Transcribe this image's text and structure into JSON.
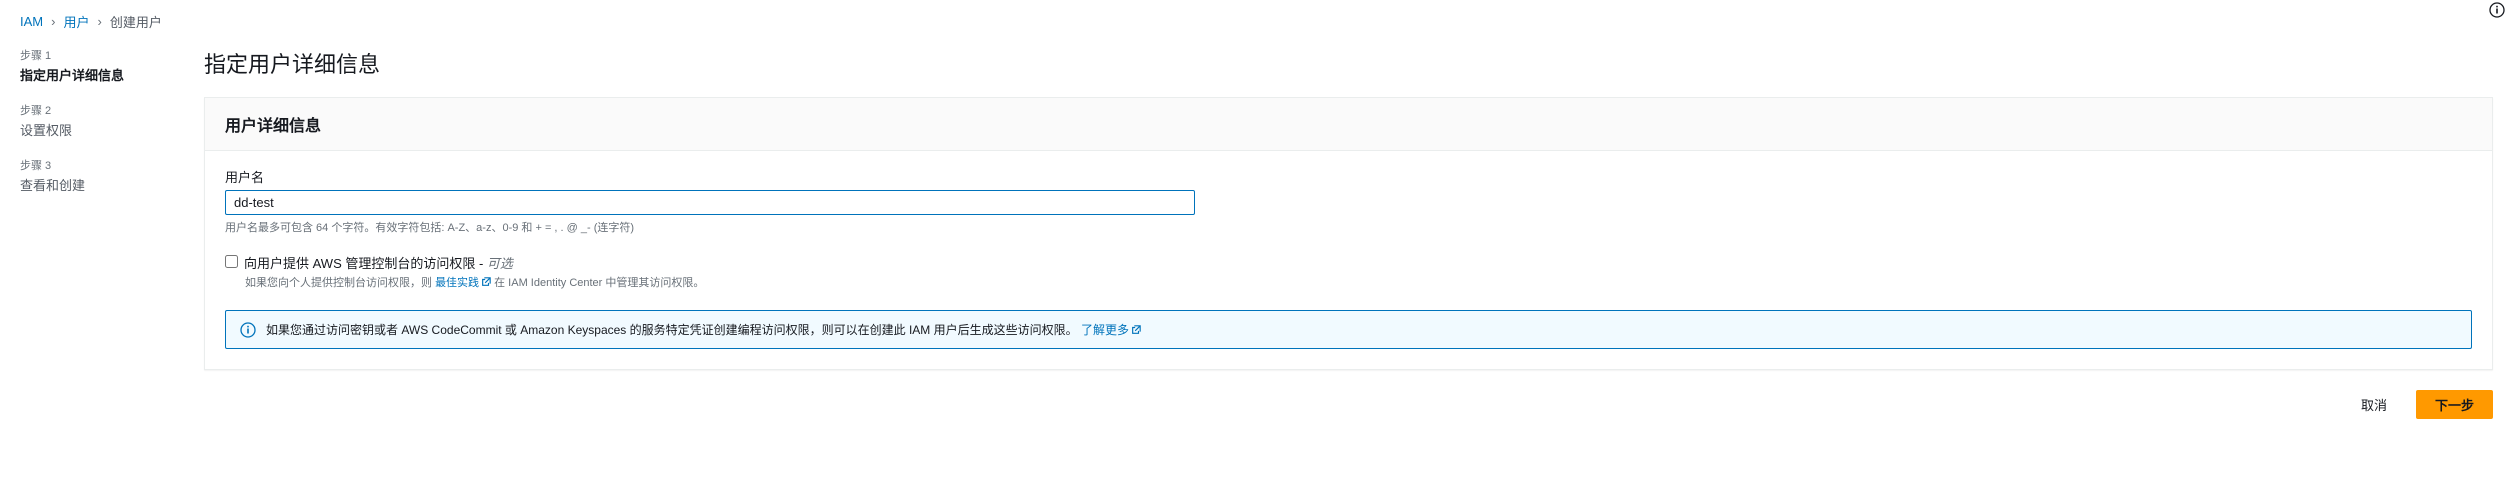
{
  "breadcrumb": {
    "items": [
      "IAM",
      "用户",
      "创建用户"
    ]
  },
  "steps": [
    {
      "num": "步骤 1",
      "label": "指定用户详细信息",
      "active": true
    },
    {
      "num": "步骤 2",
      "label": "设置权限",
      "active": false
    },
    {
      "num": "步骤 3",
      "label": "查看和创建",
      "active": false
    }
  ],
  "page_title": "指定用户详细信息",
  "panel": {
    "header": "用户详细信息",
    "username_label": "用户名",
    "username_value": "dd-test",
    "username_hint": "用户名最多可包含 64 个字符。有效字符包括: A-Z、a-z、0-9 和 + = , . @ _- (连字符)",
    "console_checkbox_label": "向用户提供 AWS 管理控制台的访问权限 -",
    "console_checkbox_optional": "可选",
    "console_sub_hint_pre": "如果您向个人提供控制台访问权限，则",
    "console_sub_hint_link": "最佳实践",
    "console_sub_hint_post": "在 IAM Identity Center 中管理其访问权限。",
    "info_text": "如果您通过访问密钥或者 AWS CodeCommit 或 Amazon Keyspaces 的服务特定凭证创建编程访问权限，则可以在创建此 IAM 用户后生成这些访问权限。",
    "info_link": "了解更多"
  },
  "buttons": {
    "cancel": "取消",
    "next": "下一步"
  }
}
